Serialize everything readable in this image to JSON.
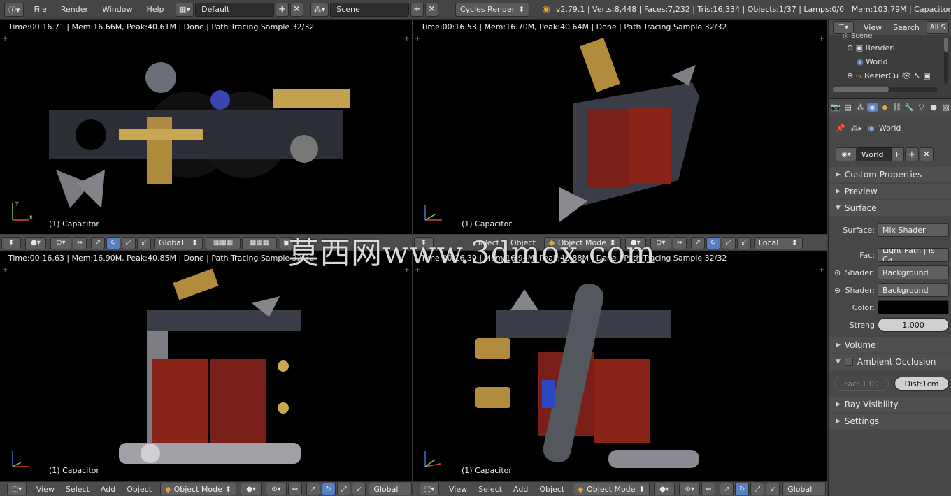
{
  "topbar": {
    "menus": [
      "File",
      "Render",
      "Window",
      "Help"
    ],
    "screen_layout": "Default",
    "scene": "Scene",
    "render_engine": "Cycles Render",
    "status": "v2.79.1 | Verts:8,448 | Faces:7,232 | Tris:16,334 | Objects:1/37 | Lamps:0/0 | Mem:103.79M | Capacitor"
  },
  "viewports": [
    {
      "status": "Time:00:16.71 | Mem:16.66M, Peak:40.61M | Done | Path Tracing Sample 32/32",
      "object": "(1) Capacitor"
    },
    {
      "status": "Time:00:16.53 | Mem:16.70M, Peak:40.64M | Done | Path Tracing Sample 32/32",
      "object": "(1) Capacitor"
    },
    {
      "status": "Time:00:16.63 | Mem:16.90M, Peak:40.85M | Done | Path Tracing Sample 32/32",
      "object": "(1) Capacitor"
    },
    {
      "status": "Time:00:16.30 | Mem:16.94M, Peak:40.88M | Done | Path Tracing Sample 32/32",
      "object": "(1) Capacitor"
    }
  ],
  "mid_headers": {
    "left": {
      "orientation": "Global"
    },
    "right": {
      "menus": [
        "Select",
        "Object"
      ],
      "mode": "Object Mode",
      "orientation": "Local"
    }
  },
  "bottom_headers": {
    "left": {
      "menus": [
        "View",
        "Select",
        "Add",
        "Object"
      ],
      "mode": "Object Mode",
      "orientation": "Global"
    },
    "right": {
      "menus": [
        "View",
        "Select",
        "Add",
        "Object"
      ],
      "mode": "Object Mode",
      "orientation": "Global"
    }
  },
  "outliner": {
    "menus": [
      "View",
      "Search",
      "All S"
    ],
    "items": [
      {
        "label": "Scene"
      },
      {
        "label": "RenderL"
      },
      {
        "label": "World"
      },
      {
        "label": "BezierCu"
      }
    ]
  },
  "properties": {
    "breadcrumb": "World",
    "datablock": "World",
    "datablock_fake": "F",
    "panels": {
      "custom_properties": "Custom Properties",
      "preview": "Preview",
      "surface": "Surface",
      "volume": "Volume",
      "ambient_occlusion": "Ambient Occlusion",
      "ray_visibility": "Ray Visibility",
      "settings": "Settings"
    },
    "surface": {
      "surface_label": "Surface:",
      "surface_value": "Mix Shader",
      "fac_label": "Fac:",
      "fac_value": "Light Path | Is Ca...",
      "shader1_label": "Shader:",
      "shader1_value": "Background",
      "shader2_label": "Shader:",
      "shader2_value": "Background",
      "color_label": "Color:",
      "color_value": "#000000",
      "strength_label": "Streng",
      "strength_value": "1.000"
    },
    "ao": {
      "fac": "Fac: 1.00",
      "dist": "Dist:1cm"
    }
  },
  "watermark": "莫西网www.3dmox.com"
}
